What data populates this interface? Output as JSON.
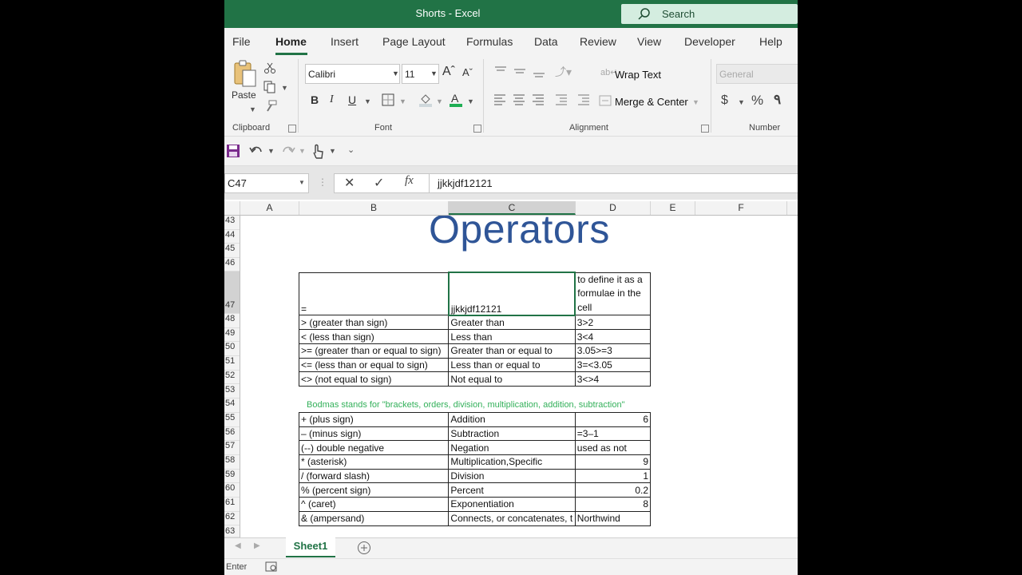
{
  "window": {
    "title": "Shorts  -  Excel",
    "search_placeholder": "Search"
  },
  "tabs": [
    "File",
    "Home",
    "Insert",
    "Page Layout",
    "Formulas",
    "Data",
    "Review",
    "View",
    "Developer",
    "Help"
  ],
  "active_tab": "Home",
  "ribbon": {
    "paste_label": "Paste",
    "font_name": "Calibri",
    "font_size": "11",
    "wrap_text": "Wrap Text",
    "merge_center": "Merge & Center",
    "number_format": "General",
    "groups": {
      "clipboard": "Clipboard",
      "font": "Font",
      "alignment": "Alignment",
      "number": "Number"
    }
  },
  "formula_bar": {
    "name_box": "C47",
    "fx": "fx",
    "formula": "jjkkjdf12121"
  },
  "columns": [
    "A",
    "B",
    "C",
    "D",
    "E",
    "F"
  ],
  "selected_column": "C",
  "rows": [
    "43",
    "44",
    "45",
    "46",
    "47",
    "48",
    "49",
    "50",
    "51",
    "52",
    "53",
    "54",
    "55",
    "56",
    "57",
    "58",
    "59",
    "60",
    "61",
    "62",
    "63"
  ],
  "selected_row": "47",
  "sheet": {
    "title": "Operators",
    "table1": [
      [
        "=",
        "jjkkjdf12121",
        "to define it as a formulae in the cell"
      ],
      [
        "> (greater than sign)",
        "Greater than",
        "3>2"
      ],
      [
        "< (less than sign)",
        "Less than",
        "3<4"
      ],
      [
        ">= (greater than or equal to sign)",
        "Greater than or equal to",
        "3.05>=3"
      ],
      [
        "<= (less than or equal to sign)",
        "Less than or equal to",
        "3=<3.05"
      ],
      [
        "<> (not equal to sign)",
        "Not equal to",
        "3<>4"
      ]
    ],
    "bodmas_note": "Bodmas stands for \"brackets, orders, division, multiplication, addition, subtraction\"",
    "table2": [
      [
        "+ (plus sign)",
        "Addition",
        "6"
      ],
      [
        "– (minus sign)",
        "Subtraction",
        "=3–1"
      ],
      [
        "(--) double negative",
        "Negation",
        "used as not"
      ],
      [
        "* (asterisk)",
        "Multiplication,Specific",
        "9"
      ],
      [
        "/ (forward slash)",
        "Division",
        "1"
      ],
      [
        "% (percent sign)",
        "Percent",
        "0.2"
      ],
      [
        "^ (caret)",
        "Exponentiation",
        "8"
      ],
      [
        "& (ampersand)",
        "Connects, or concatenates, t",
        "Northwind"
      ]
    ]
  },
  "sheet_tab": "Sheet1",
  "status": "Enter",
  "colors": {
    "excel_green": "#217346",
    "title_blue": "#2f5597",
    "note_green": "#33b05a"
  }
}
